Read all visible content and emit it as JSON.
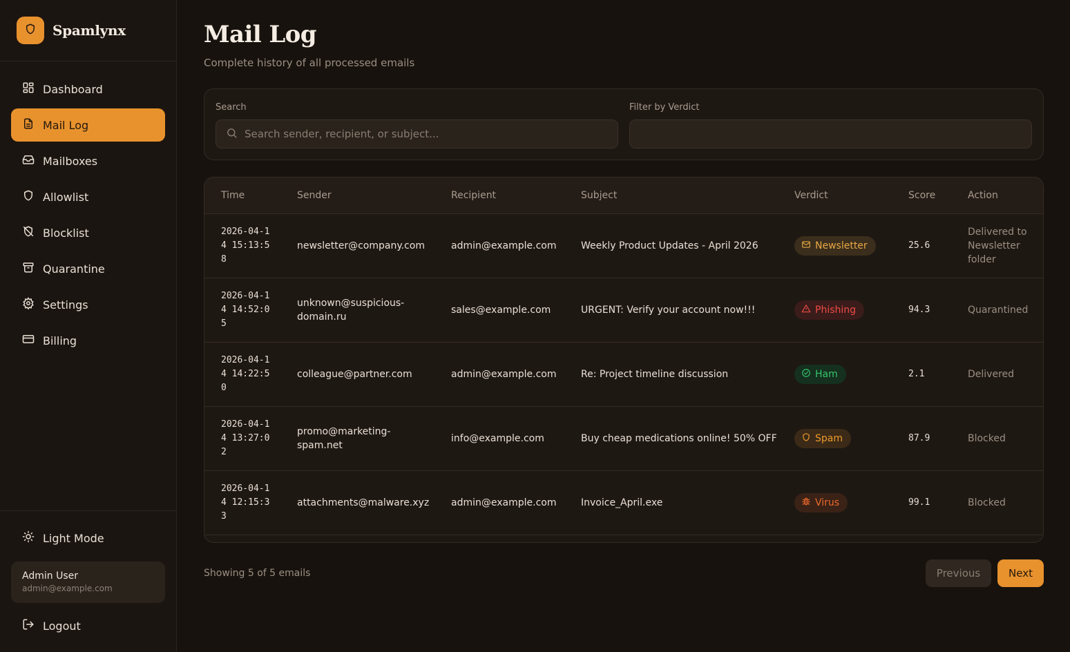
{
  "brand": {
    "name": "Spamlynx",
    "icon": "shield-icon",
    "accent": "#e8922e"
  },
  "sidebar": {
    "items": [
      {
        "label": "Dashboard",
        "icon": "dashboard-icon",
        "active": false
      },
      {
        "label": "Mail Log",
        "icon": "document-icon",
        "active": true
      },
      {
        "label": "Mailboxes",
        "icon": "inbox-icon",
        "active": false
      },
      {
        "label": "Allowlist",
        "icon": "shield-icon",
        "active": false
      },
      {
        "label": "Blocklist",
        "icon": "shield-off-icon",
        "active": false
      },
      {
        "label": "Quarantine",
        "icon": "archive-icon",
        "active": false
      },
      {
        "label": "Settings",
        "icon": "gear-icon",
        "active": false
      },
      {
        "label": "Billing",
        "icon": "credit-card-icon",
        "active": false
      }
    ],
    "theme_toggle": "Light Mode",
    "user": {
      "name": "Admin User",
      "email": "admin@example.com"
    },
    "logout": "Logout"
  },
  "page": {
    "title": "Mail Log",
    "subtitle": "Complete history of all processed emails"
  },
  "filters": {
    "search_label": "Search",
    "search_placeholder": "Search sender, recipient, or subject...",
    "search_value": "",
    "verdict_label": "Filter by Verdict",
    "verdict_value": ""
  },
  "table": {
    "columns": [
      "Time",
      "Sender",
      "Recipient",
      "Subject",
      "Verdict",
      "Score",
      "Action"
    ],
    "rows": [
      {
        "time": "2026-04-14 15:13:58",
        "sender": "newsletter@company.com",
        "recipient": "admin@example.com",
        "subject": "Weekly Product Updates - April 2026",
        "verdict": "Newsletter",
        "verdict_icon": "mail-icon",
        "score": "25.6",
        "action": "Delivered to Newsletter folder"
      },
      {
        "time": "2026-04-14 14:52:05",
        "sender": "unknown@suspicious-domain.ru",
        "recipient": "sales@example.com",
        "subject": "URGENT: Verify your account now!!!",
        "verdict": "Phishing",
        "verdict_icon": "warning-icon",
        "score": "94.3",
        "action": "Quarantined"
      },
      {
        "time": "2026-04-14 14:22:50",
        "sender": "colleague@partner.com",
        "recipient": "admin@example.com",
        "subject": "Re: Project timeline discussion",
        "verdict": "Ham",
        "verdict_icon": "check-circle-icon",
        "score": "2.1",
        "action": "Delivered"
      },
      {
        "time": "2026-04-14 13:27:02",
        "sender": "promo@marketing-spam.net",
        "recipient": "info@example.com",
        "subject": "Buy cheap medications online! 50% OFF",
        "verdict": "Spam",
        "verdict_icon": "shield-icon",
        "score": "87.9",
        "action": "Blocked"
      },
      {
        "time": "2026-04-14 12:15:33",
        "sender": "attachments@malware.xyz",
        "recipient": "admin@example.com",
        "subject": "Invoice_April.exe",
        "verdict": "Virus",
        "verdict_icon": "bug-icon",
        "score": "99.1",
        "action": "Blocked"
      }
    ]
  },
  "pagination": {
    "showing": "Showing 5 of 5 emails",
    "previous": "Previous",
    "next": "Next"
  }
}
